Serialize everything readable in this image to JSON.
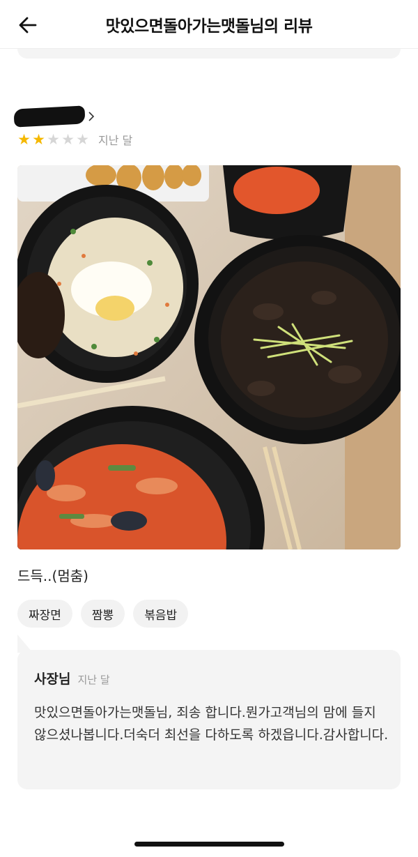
{
  "header": {
    "title": "맛있으면돌아가는맷돌님의 리뷰"
  },
  "review": {
    "rating": 2,
    "max_rating": 5,
    "date": "지난 달",
    "comment": "드득..(멈춤)",
    "menu_tags": [
      "짜장면",
      "짬뽕",
      "볶음밥"
    ]
  },
  "owner_reply": {
    "name": "사장님",
    "date": "지난 달",
    "text": "맛있으면돌아가는맷돌님, 죄송  합니다.뭔가고객님의 맘에  들지  않으셨나봅니다.더숙더  최선을 다하도록 하겠읍니다.감사합니다."
  },
  "colors": {
    "star_filled": "#f5b800",
    "star_empty": "#d6d6d6",
    "muted_text": "#999999",
    "panel_bg": "#f4f4f4"
  },
  "icons": {
    "back": "left-arrow-icon",
    "reviewer_chevron": "chevron-right-icon"
  }
}
